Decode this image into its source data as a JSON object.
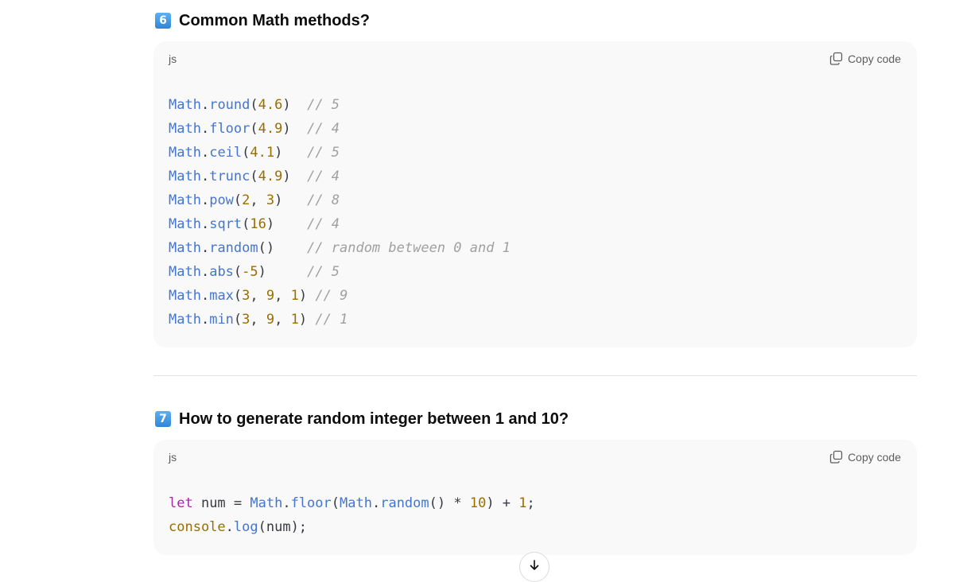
{
  "sections": [
    {
      "badge": "6",
      "title": "Common Math methods?",
      "code": {
        "language": "js",
        "copy_label": "Copy code",
        "lines": [
          [
            {
              "t": "Math",
              "c": "obj"
            },
            {
              "t": ".",
              "c": "pl"
            },
            {
              "t": "round",
              "c": "obj"
            },
            {
              "t": "(",
              "c": "pl"
            },
            {
              "t": "4.6",
              "c": "num"
            },
            {
              "t": ")  ",
              "c": "pl"
            },
            {
              "t": "// 5",
              "c": "cmt"
            }
          ],
          [
            {
              "t": "Math",
              "c": "obj"
            },
            {
              "t": ".",
              "c": "pl"
            },
            {
              "t": "floor",
              "c": "obj"
            },
            {
              "t": "(",
              "c": "pl"
            },
            {
              "t": "4.9",
              "c": "num"
            },
            {
              "t": ")  ",
              "c": "pl"
            },
            {
              "t": "// 4",
              "c": "cmt"
            }
          ],
          [
            {
              "t": "Math",
              "c": "obj"
            },
            {
              "t": ".",
              "c": "pl"
            },
            {
              "t": "ceil",
              "c": "obj"
            },
            {
              "t": "(",
              "c": "pl"
            },
            {
              "t": "4.1",
              "c": "num"
            },
            {
              "t": ")   ",
              "c": "pl"
            },
            {
              "t": "// 5",
              "c": "cmt"
            }
          ],
          [
            {
              "t": "Math",
              "c": "obj"
            },
            {
              "t": ".",
              "c": "pl"
            },
            {
              "t": "trunc",
              "c": "obj"
            },
            {
              "t": "(",
              "c": "pl"
            },
            {
              "t": "4.9",
              "c": "num"
            },
            {
              "t": ")  ",
              "c": "pl"
            },
            {
              "t": "// 4",
              "c": "cmt"
            }
          ],
          [
            {
              "t": "Math",
              "c": "obj"
            },
            {
              "t": ".",
              "c": "pl"
            },
            {
              "t": "pow",
              "c": "obj"
            },
            {
              "t": "(",
              "c": "pl"
            },
            {
              "t": "2",
              "c": "num"
            },
            {
              "t": ", ",
              "c": "pl"
            },
            {
              "t": "3",
              "c": "num"
            },
            {
              "t": ")   ",
              "c": "pl"
            },
            {
              "t": "// 8",
              "c": "cmt"
            }
          ],
          [
            {
              "t": "Math",
              "c": "obj"
            },
            {
              "t": ".",
              "c": "pl"
            },
            {
              "t": "sqrt",
              "c": "obj"
            },
            {
              "t": "(",
              "c": "pl"
            },
            {
              "t": "16",
              "c": "num"
            },
            {
              "t": ")    ",
              "c": "pl"
            },
            {
              "t": "// 4",
              "c": "cmt"
            }
          ],
          [
            {
              "t": "Math",
              "c": "obj"
            },
            {
              "t": ".",
              "c": "pl"
            },
            {
              "t": "random",
              "c": "obj"
            },
            {
              "t": "()    ",
              "c": "pl"
            },
            {
              "t": "// random between 0 and 1",
              "c": "cmt"
            }
          ],
          [
            {
              "t": "Math",
              "c": "obj"
            },
            {
              "t": ".",
              "c": "pl"
            },
            {
              "t": "abs",
              "c": "obj"
            },
            {
              "t": "(",
              "c": "pl"
            },
            {
              "t": "-5",
              "c": "num"
            },
            {
              "t": ")     ",
              "c": "pl"
            },
            {
              "t": "// 5",
              "c": "cmt"
            }
          ],
          [
            {
              "t": "Math",
              "c": "obj"
            },
            {
              "t": ".",
              "c": "pl"
            },
            {
              "t": "max",
              "c": "obj"
            },
            {
              "t": "(",
              "c": "pl"
            },
            {
              "t": "3",
              "c": "num"
            },
            {
              "t": ", ",
              "c": "pl"
            },
            {
              "t": "9",
              "c": "num"
            },
            {
              "t": ", ",
              "c": "pl"
            },
            {
              "t": "1",
              "c": "num"
            },
            {
              "t": ") ",
              "c": "pl"
            },
            {
              "t": "// 9",
              "c": "cmt"
            }
          ],
          [
            {
              "t": "Math",
              "c": "obj"
            },
            {
              "t": ".",
              "c": "pl"
            },
            {
              "t": "min",
              "c": "obj"
            },
            {
              "t": "(",
              "c": "pl"
            },
            {
              "t": "3",
              "c": "num"
            },
            {
              "t": ", ",
              "c": "pl"
            },
            {
              "t": "9",
              "c": "num"
            },
            {
              "t": ", ",
              "c": "pl"
            },
            {
              "t": "1",
              "c": "num"
            },
            {
              "t": ") ",
              "c": "pl"
            },
            {
              "t": "// 1",
              "c": "cmt"
            }
          ]
        ]
      }
    },
    {
      "badge": "7",
      "title": "How to generate random integer between 1 and 10?",
      "code": {
        "language": "js",
        "copy_label": "Copy code",
        "lines": [
          [
            {
              "t": "let",
              "c": "kw"
            },
            {
              "t": " num = ",
              "c": "pl"
            },
            {
              "t": "Math",
              "c": "obj"
            },
            {
              "t": ".",
              "c": "pl"
            },
            {
              "t": "floor",
              "c": "obj"
            },
            {
              "t": "(",
              "c": "pl"
            },
            {
              "t": "Math",
              "c": "obj"
            },
            {
              "t": ".",
              "c": "pl"
            },
            {
              "t": "random",
              "c": "obj"
            },
            {
              "t": "() * ",
              "c": "pl"
            },
            {
              "t": "10",
              "c": "num"
            },
            {
              "t": ") + ",
              "c": "pl"
            },
            {
              "t": "1",
              "c": "num"
            },
            {
              "t": ";",
              "c": "pl"
            }
          ],
          [
            {
              "t": "console",
              "c": "num"
            },
            {
              "t": ".",
              "c": "pl"
            },
            {
              "t": "log",
              "c": "obj"
            },
            {
              "t": "(num);",
              "c": "pl"
            }
          ]
        ]
      }
    }
  ],
  "scroll_button": {
    "icon": "arrow-down-icon"
  }
}
